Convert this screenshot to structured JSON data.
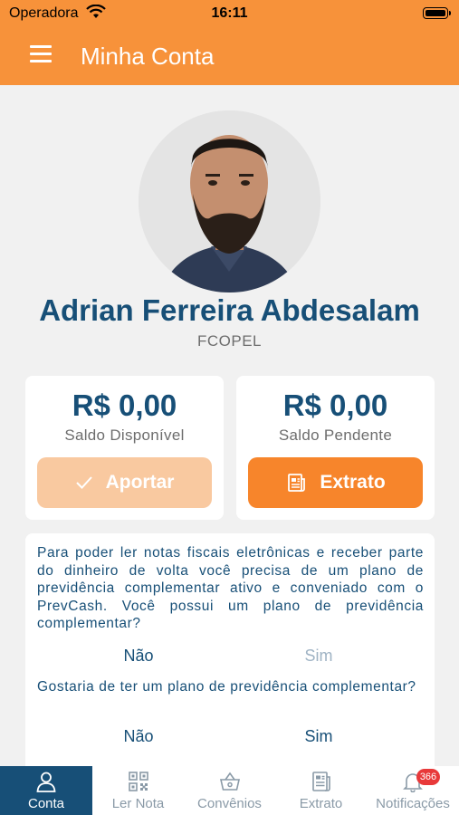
{
  "status_bar": {
    "carrier": "Operadora",
    "time": "16:11"
  },
  "app_bar": {
    "title": "Minha Conta",
    "menu_icon": "hamburger-menu-icon"
  },
  "profile": {
    "name": "Adrian Ferreira Abdesalam",
    "organization": "FCOPEL"
  },
  "balances": {
    "available": {
      "amount": "R$ 0,00",
      "label": "Saldo Disponível",
      "button": "Aportar",
      "button_icon": "check-icon",
      "button_state": "disabled"
    },
    "pending": {
      "amount": "R$ 0,00",
      "label": "Saldo Pendente",
      "button": "Extrato",
      "button_icon": "statement-icon"
    }
  },
  "questions": [
    {
      "text": "Para poder ler notas fiscais eletrônicas e receber parte do dinheiro de volta você precisa de um plano de previdência complementar ativo e conveniado com o PrevCash. Você possui um plano de previdência complementar?",
      "no": "Não",
      "yes": "Sim"
    },
    {
      "text": "Gostaria de ter um plano de previdência complementar?",
      "no": "Não",
      "yes": "Sim"
    }
  ],
  "tabs": [
    {
      "label": "Conta",
      "icon": "user-icon",
      "active": true
    },
    {
      "label": "Ler Nota",
      "icon": "qr-code-icon"
    },
    {
      "label": "Convênios",
      "icon": "basket-icon"
    },
    {
      "label": "Extrato",
      "icon": "receipt-icon"
    },
    {
      "label": "Notificações",
      "icon": "bell-icon",
      "badge": "366"
    }
  ],
  "colors": {
    "accent": "#f7923a",
    "primary": "#174f77",
    "button": "#f7852b",
    "badge": "#e8393a"
  }
}
